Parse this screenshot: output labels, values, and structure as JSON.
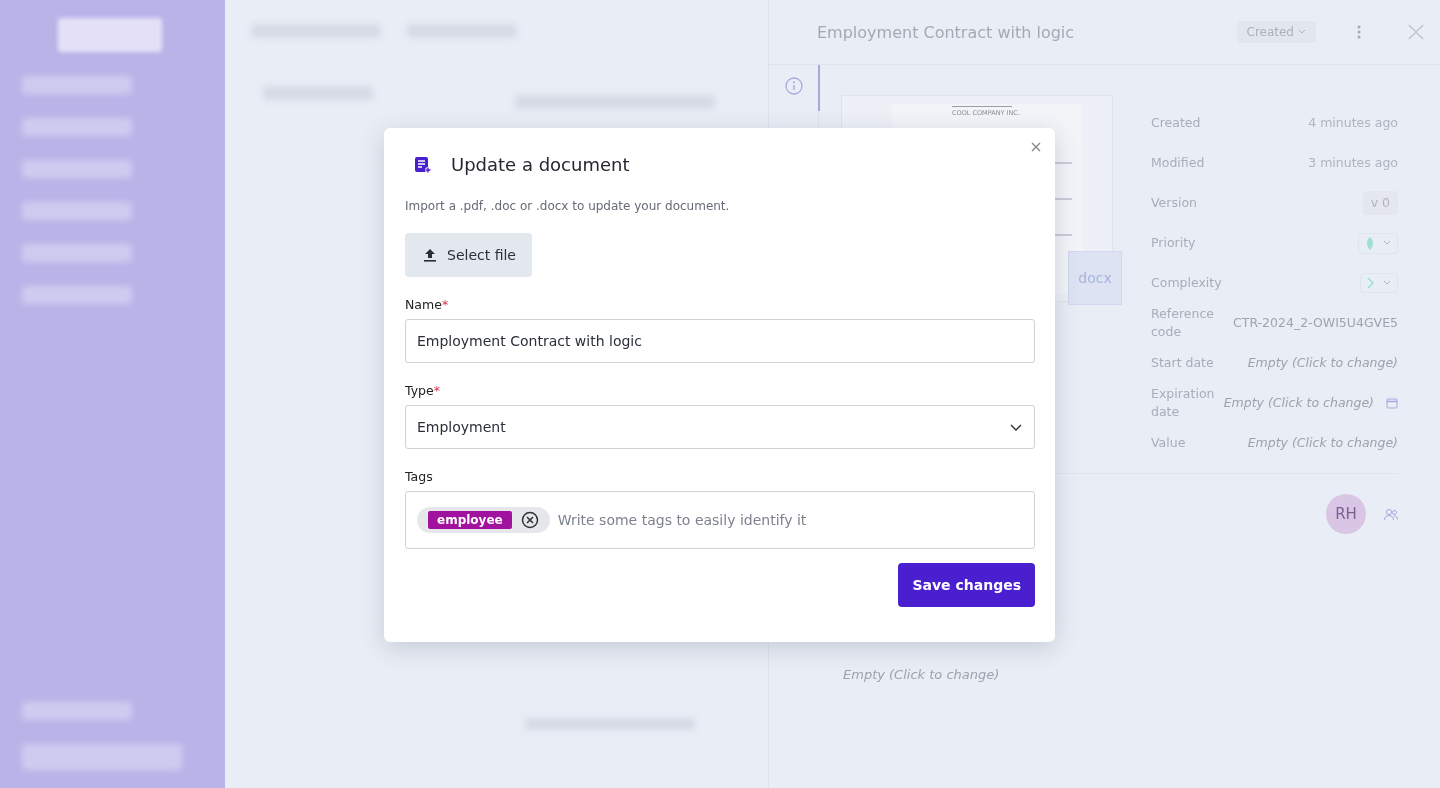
{
  "detail_panel": {
    "title": "Employment Contract with logic",
    "status": "Created",
    "preview": {
      "company": "COOL COMPANY INC.",
      "format": "docx"
    },
    "properties": [
      {
        "label": "Created",
        "value": "4 minutes ago",
        "kind": "text"
      },
      {
        "label": "Modified",
        "value": "3 minutes ago",
        "kind": "text"
      },
      {
        "label": "Version",
        "value": "v 0",
        "kind": "pill"
      },
      {
        "label": "Priority",
        "kind": "priority"
      },
      {
        "label": "Complexity",
        "kind": "complexity"
      },
      {
        "label": "Reference code",
        "value": "CTR-2024_2-OWI5U4GVE5",
        "kind": "code"
      },
      {
        "label": "Start date",
        "value": "Empty (Click to change)",
        "kind": "empty"
      },
      {
        "label": "Expiration date",
        "value": "Empty (Click to change)",
        "kind": "date"
      },
      {
        "label": "Value",
        "value": "Empty (Click to change)",
        "kind": "empty"
      }
    ],
    "avatar": "RH",
    "notes_placeholder": "Empty (Click to change)"
  },
  "modal": {
    "title": "Update a document",
    "description": "Import a .pdf, .doc or .docx to update your document.",
    "upload_button": "Select file",
    "fields": [
      {
        "kind": "text",
        "label": "Name",
        "required_mark": "*",
        "value": "Employment Contract with logic"
      },
      {
        "kind": "select",
        "label": "Type",
        "required_mark": "*",
        "value": "Employment"
      },
      {
        "kind": "tags",
        "label": "Tags",
        "tags": [
          "employee"
        ],
        "placeholder": "Write some tags to easily identify it"
      }
    ],
    "save_button": "Save changes"
  }
}
